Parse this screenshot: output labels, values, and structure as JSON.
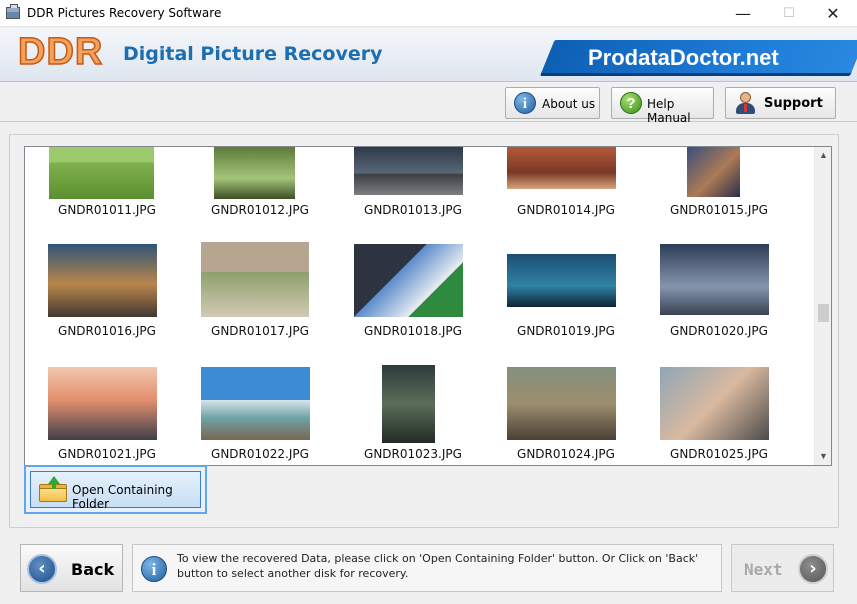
{
  "window": {
    "title": "DDR Pictures Recovery Software",
    "controls": {
      "minimize": "—",
      "maximize": "☐",
      "close": "✕"
    }
  },
  "header": {
    "logo": "DDR",
    "title": "Digital Picture Recovery",
    "brand": "ProdataDoctor.net"
  },
  "toolbar": {
    "about_label": "About us",
    "help_label": "Help Manual",
    "support_label": "Support"
  },
  "gallery": {
    "items": [
      {
        "name": "GNDR01011.JPG",
        "icon": "photo-thumbnail"
      },
      {
        "name": "GNDR01012.JPG",
        "icon": "photo-thumbnail"
      },
      {
        "name": "GNDR01013.JPG",
        "icon": "photo-thumbnail"
      },
      {
        "name": "GNDR01014.JPG",
        "icon": "photo-thumbnail"
      },
      {
        "name": "GNDR01015.JPG",
        "icon": "photo-thumbnail"
      },
      {
        "name": "GNDR01016.JPG",
        "icon": "photo-thumbnail"
      },
      {
        "name": "GNDR01017.JPG",
        "icon": "photo-thumbnail"
      },
      {
        "name": "GNDR01018.JPG",
        "icon": "photo-thumbnail"
      },
      {
        "name": "GNDR01019.JPG",
        "icon": "photo-thumbnail"
      },
      {
        "name": "GNDR01020.JPG",
        "icon": "photo-thumbnail"
      },
      {
        "name": "GNDR01021.JPG",
        "icon": "photo-thumbnail"
      },
      {
        "name": "GNDR01022.JPG",
        "icon": "photo-thumbnail"
      },
      {
        "name": "GNDR01023.JPG",
        "icon": "photo-thumbnail"
      },
      {
        "name": "GNDR01024.JPG",
        "icon": "photo-thumbnail"
      },
      {
        "name": "GNDR01025.JPG",
        "icon": "photo-thumbnail"
      }
    ],
    "scroll_up": "▲",
    "scroll_down": "▼"
  },
  "actions": {
    "open_folder_label": "Open Containing Folder"
  },
  "footer": {
    "back_label": "Back",
    "next_label": "Next",
    "info_message": "To view the recovered Data, please click on 'Open Containing Folder' button. Or Click on 'Back' button to select another disk for recovery."
  },
  "colors": {
    "brand_blue": "#1d6eb0",
    "logo_orange": "#f4a15a",
    "selection_blue": "#63a6e6"
  }
}
